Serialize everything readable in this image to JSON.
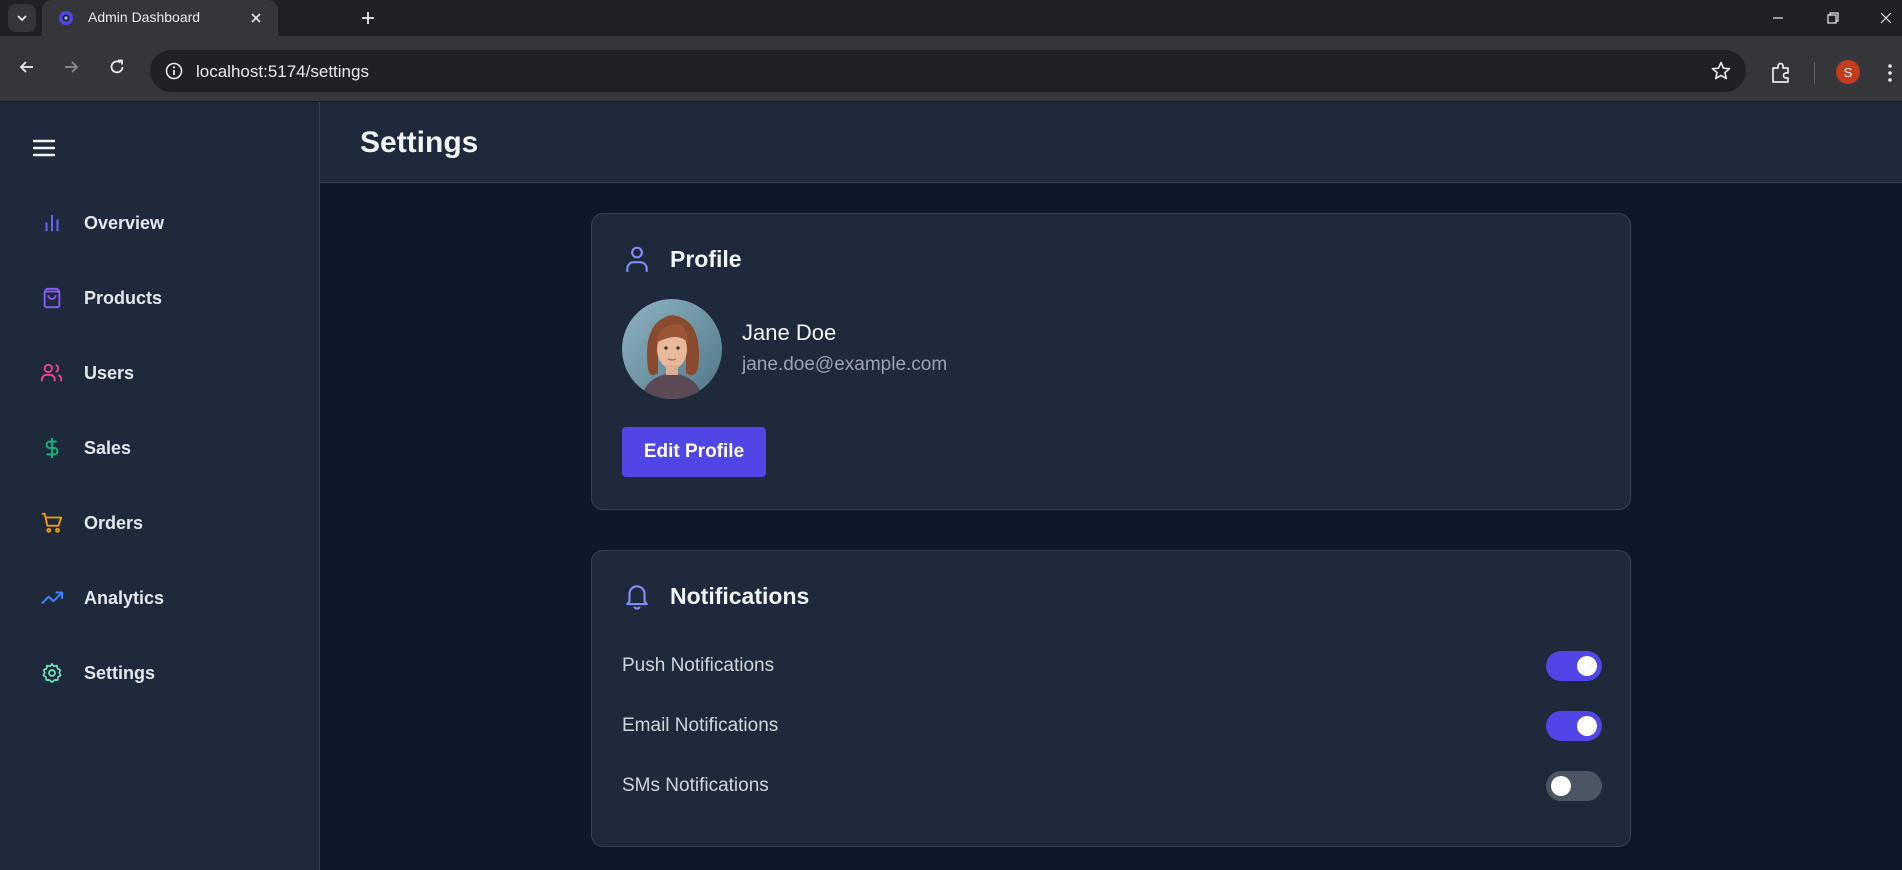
{
  "browser": {
    "tab_title": "Admin Dashboard",
    "url": "localhost:5174/settings",
    "profile_initial": "S"
  },
  "sidebar": {
    "items": [
      {
        "label": "Overview",
        "icon": "bar-chart-icon",
        "color": "#6366f1"
      },
      {
        "label": "Products",
        "icon": "shopping-bag-icon",
        "color": "#8b5cf6"
      },
      {
        "label": "Users",
        "icon": "users-icon",
        "color": "#ec4899"
      },
      {
        "label": "Sales",
        "icon": "dollar-sign-icon",
        "color": "#10b981"
      },
      {
        "label": "Orders",
        "icon": "shopping-cart-icon",
        "color": "#f59e0b"
      },
      {
        "label": "Analytics",
        "icon": "trending-up-icon",
        "color": "#3b82f6"
      },
      {
        "label": "Settings",
        "icon": "settings-icon",
        "color": "#6ee7b7"
      }
    ]
  },
  "header": {
    "title": "Settings"
  },
  "profile": {
    "section_title": "Profile",
    "name": "Jane Doe",
    "email": "jane.doe@example.com",
    "edit_label": "Edit Profile"
  },
  "notifications": {
    "section_title": "Notifications",
    "items": [
      {
        "label": "Push Notifications",
        "enabled": true
      },
      {
        "label": "Email Notifications",
        "enabled": true
      },
      {
        "label": "SMs Notifications",
        "enabled": false
      }
    ]
  },
  "colors": {
    "accent": "#4f46e5",
    "card_icon": "#818cf8",
    "background": "#0f172a",
    "panel": "#1e293b"
  }
}
